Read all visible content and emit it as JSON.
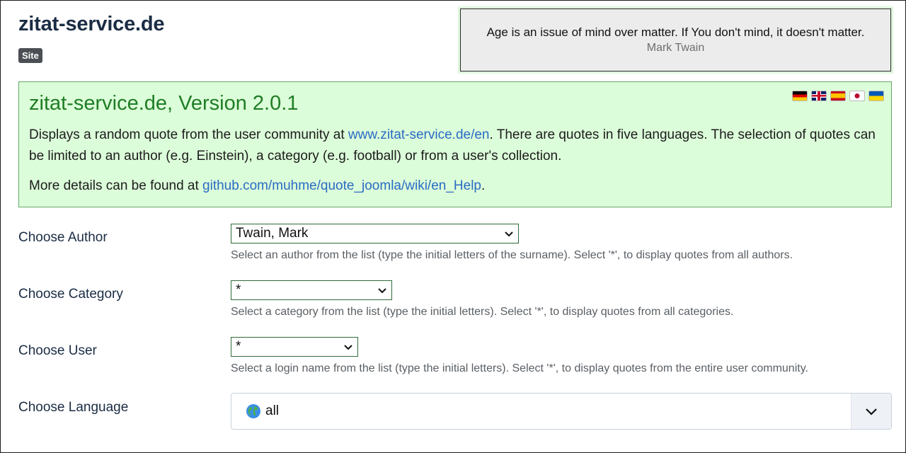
{
  "header": {
    "site_title": "zitat-service.de",
    "badge": "Site"
  },
  "quote": {
    "text": "Age is an issue of mind over matter. If You don't mind, it doesn't matter.",
    "author": "Mark Twain"
  },
  "info": {
    "title": "zitat-service.de, Version 2.0.1",
    "p1_before": "Displays a random quote from the user community at ",
    "p1_link": "www.zitat-service.de/en",
    "p1_after": ". There are quotes in five languages. The selection of quotes can be limited to an author (e.g. Einstein), a category (e.g. football) or from a user's collection.",
    "p2_before": "More details can be found at ",
    "p2_link": "github.com/muhme/quote_joomla/wiki/en_Help",
    "p2_after": ".",
    "flags": [
      "flag-de-icon",
      "flag-uk-icon",
      "flag-es-icon",
      "flag-jp-icon",
      "flag-ua-icon"
    ]
  },
  "fields": {
    "author": {
      "label": "Choose Author",
      "value": "Twain, Mark",
      "help": "Select an author from the list (type the initial letters of the surname). Select '*', to display quotes from all authors."
    },
    "category": {
      "label": "Choose Category",
      "value": "*",
      "help": "Select a category from the list (type the initial letters). Select '*', to display quotes from all categories."
    },
    "user": {
      "label": "Choose User",
      "value": "*",
      "help": "Select a login name from the list (type the initial letters). Select '*', to display quotes from the entire user community."
    },
    "language": {
      "label": "Choose Language",
      "value": "all",
      "icon": "globe-icon"
    }
  },
  "colors": {
    "title": "#1b2c44",
    "info_bg": "#dcfdd9",
    "info_title": "#1f7d25",
    "link": "#2a6bc5"
  }
}
